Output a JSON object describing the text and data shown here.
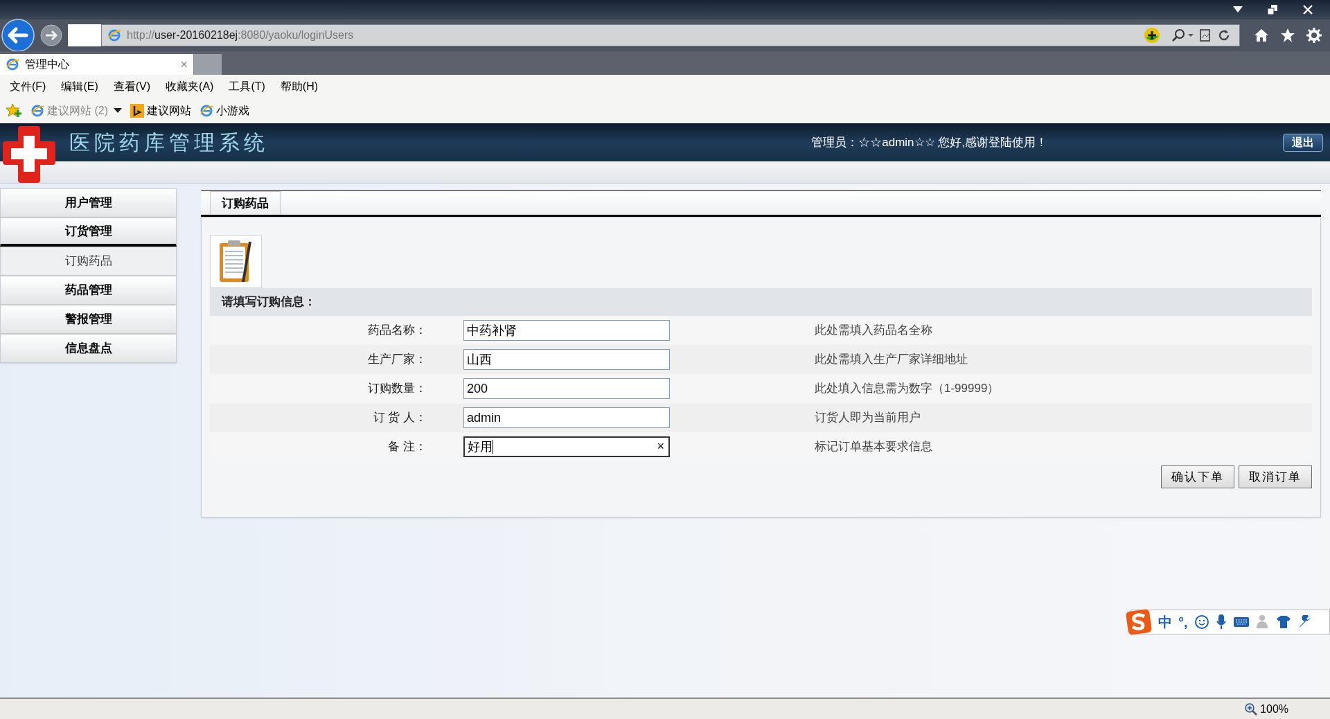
{
  "browser": {
    "url_parts": [
      {
        "text": "http://",
        "strong": false
      },
      {
        "text": "user-20160218ej",
        "strong": true
      },
      {
        "text": ":8080/yaoku/loginUsers",
        "strong": false
      }
    ],
    "tab": {
      "title": "管理中心",
      "close": "×"
    },
    "menu": [
      "文件(F)",
      "编辑(E)",
      "查看(V)",
      "收藏夹(A)",
      "工具(T)",
      "帮助(H)"
    ],
    "favorites": [
      {
        "label": "建议网站 (2)",
        "kind": "ie",
        "muted": true,
        "dropdown": true
      },
      {
        "label": "建议网站",
        "kind": "bing",
        "muted": false,
        "dropdown": false
      },
      {
        "label": "小游戏",
        "kind": "ie",
        "muted": false,
        "dropdown": false
      }
    ]
  },
  "header": {
    "title": "医院药库管理系统",
    "welcome": "管理员：☆☆admin☆☆ 您好,感谢登陆使用！",
    "logout": "退出"
  },
  "sidebar": {
    "items": [
      {
        "label": "用户管理",
        "expanded": false
      },
      {
        "label": "订货管理",
        "expanded": true,
        "children": [
          {
            "label": "订购药品",
            "selected": true
          }
        ]
      },
      {
        "label": "药品管理",
        "expanded": false
      },
      {
        "label": "警报管理",
        "expanded": false
      },
      {
        "label": "信息盘点",
        "expanded": false
      }
    ]
  },
  "panel": {
    "tab": "订购药品",
    "section": "请填写订购信息：",
    "fields": [
      {
        "label": "药品名称：",
        "value": "中药补肾",
        "hint": "此处需填入药品名全称",
        "focused": false
      },
      {
        "label": "生产厂家：",
        "value": "山西",
        "hint": "此处需填入生产厂家详细地址",
        "focused": false
      },
      {
        "label": "订购数量：",
        "value": "200",
        "hint": "此处填入信息需为数字（1-99999）",
        "focused": false
      },
      {
        "label": "订 货 人：",
        "value": "admin",
        "hint": "订货人即为当前用户",
        "focused": false
      },
      {
        "label": "备 注：",
        "value": "好用",
        "hint": "标记订单基本要求信息",
        "focused": true,
        "clear": "×"
      }
    ],
    "buttons": [
      "确认下单",
      "取消订单"
    ]
  },
  "ime": {
    "mode": "中",
    "punct": "°,"
  },
  "status_bar": {
    "zoom": "100%"
  }
}
